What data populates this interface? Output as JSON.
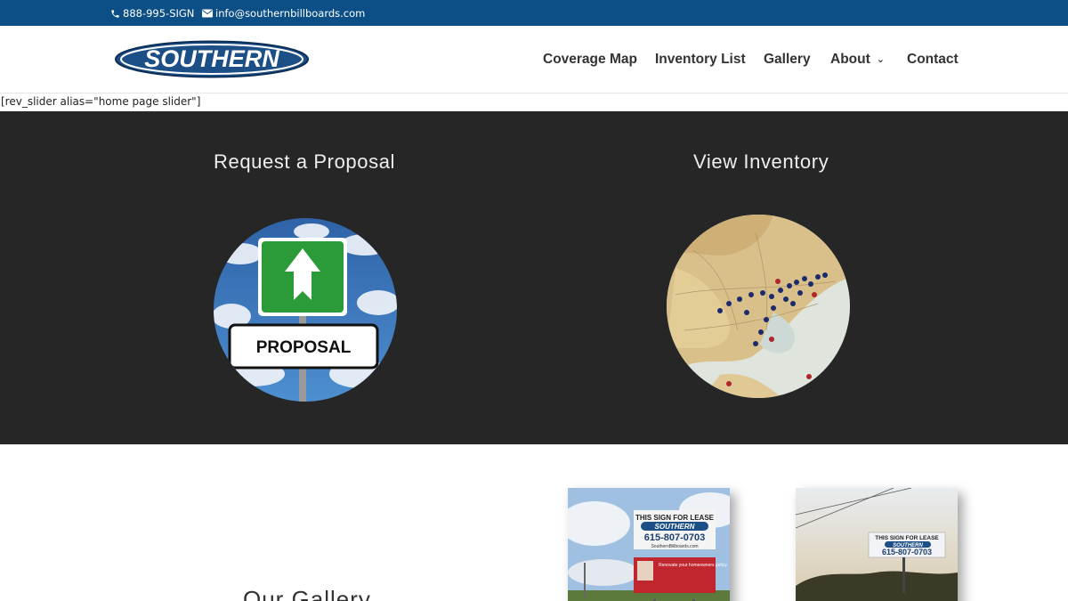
{
  "topbar": {
    "phone": "888-995-SIGN",
    "email": "info@southernbillboards.com",
    "bg_color": "#0b4f86"
  },
  "header": {
    "logo_text": "SOUTHERN",
    "brand_color": "#1b4f86",
    "nav": [
      {
        "label": "Coverage Map"
      },
      {
        "label": "Inventory List"
      },
      {
        "label": "Gallery"
      },
      {
        "label": "About",
        "has_dropdown": true
      },
      {
        "label": "Contact"
      }
    ],
    "dropdown_icon": "chevron-down-icon"
  },
  "shortcode_text": "[rev_slider alias=\"home page slider\"]",
  "features": {
    "bg_color": "#262626",
    "left": {
      "title": "Request a Proposal",
      "sign_text": "PROPOSAL"
    },
    "right": {
      "title": "View Inventory"
    }
  },
  "gallery": {
    "title": "Our Gallery",
    "photo1": {
      "line1": "THIS SIGN FOR LEASE",
      "brand": "SOUTHERN",
      "phone": "615-807-0703",
      "site": "SouthernBillboards.com",
      "ad_text": "Renovate your homeowners policy."
    },
    "photo2": {
      "line1": "THIS SIGN FOR LEASE",
      "brand": "SOUTHERN",
      "phone": "615-807-0703"
    }
  }
}
